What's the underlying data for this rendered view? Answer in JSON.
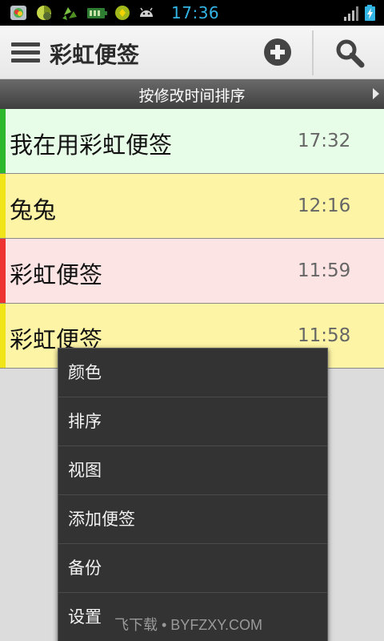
{
  "status_bar": {
    "time": "17:36",
    "icons": [
      "photo-app-icon",
      "pie-chart-icon",
      "recycle-icon",
      "battery-widget-icon",
      "android-market-icon",
      "android-icon",
      "signal-icon",
      "battery-charging-icon"
    ]
  },
  "action_bar": {
    "title": "彩虹便签",
    "icons": {
      "menu": "menu-icon",
      "add": "add-icon",
      "search": "search-icon"
    }
  },
  "sort_bar": {
    "label": "按修改时间排序"
  },
  "notes": [
    {
      "title": "我在用彩虹便签",
      "time": "17:32",
      "bg_color": "#e8fde8",
      "stripe_color": "#2eb82e"
    },
    {
      "title": "兔兔",
      "time": "12:16",
      "bg_color": "#fdf4a6",
      "stripe_color": "#f1e51a"
    },
    {
      "title": "彩虹便签",
      "time": "11:59",
      "bg_color": "#fde4e4",
      "stripe_color": "#ee3333"
    },
    {
      "title": "彩虹便签",
      "time": "11:58",
      "bg_color": "#fdf4a6",
      "stripe_color": "#f1e51a"
    }
  ],
  "popup_menu": {
    "items": [
      "颜色",
      "排序",
      "视图",
      "添加便签",
      "备份",
      "设置"
    ]
  },
  "watermark": "飞下载 • BYFZXY.COM"
}
